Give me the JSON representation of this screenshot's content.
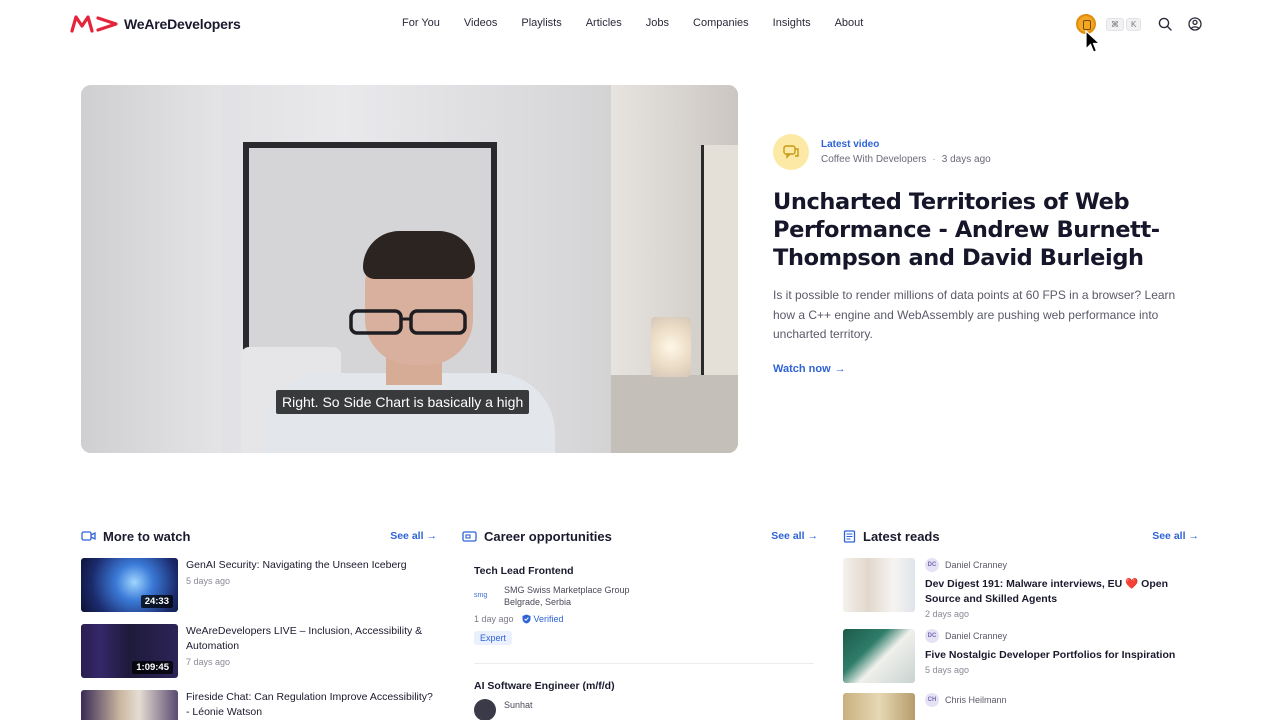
{
  "header": {
    "logo_text": "WeAreDevelopers",
    "nav": [
      "For You",
      "Videos",
      "Playlists",
      "Articles",
      "Jobs",
      "Companies",
      "Insights",
      "About"
    ],
    "shortcut_keys": [
      "⌘",
      "K"
    ]
  },
  "hero": {
    "subtitle_caption": "Right. So Side Chart is basically a high",
    "badge_label": "Latest video",
    "channel": "Coffee With Developers",
    "separator": "·",
    "age": "3 days ago",
    "title": "Uncharted Territories of Web Performance - Andrew Burnett-Thompson and David Burleigh",
    "description": "Is it possible to render millions of data points at 60 FPS in a browser? Learn how a C++ engine and WebAssembly are pushing web performance into uncharted territory.",
    "cta": "Watch now",
    "cta_arrow": "→"
  },
  "more_to_watch": {
    "title": "More to watch",
    "see_all": "See all",
    "items": [
      {
        "title": "GenAI Security: Navigating the Unseen Iceberg",
        "date": "5 days ago",
        "duration": "24:33"
      },
      {
        "title": "WeAreDevelopers LIVE – Inclusion, Accessibility & Automation",
        "date": "7 days ago",
        "duration": "1:09:45"
      },
      {
        "title": "Fireside Chat: Can Regulation Improve Accessibility? - Léonie Watson",
        "date": "",
        "duration": ""
      }
    ]
  },
  "careers": {
    "title": "Career opportunities",
    "see_all": "See all",
    "jobs": [
      {
        "title": "Tech Lead Frontend",
        "logo_text": "smg",
        "company": "SMG Swiss Marketplace Group",
        "location": "Belgrade, Serbia",
        "age": "1 day ago",
        "verified": "Verified",
        "tag": "Expert"
      },
      {
        "title": "AI Software Engineer (m/f/d)",
        "company": "Sunhat"
      }
    ]
  },
  "latest_reads": {
    "title": "Latest reads",
    "see_all": "See all",
    "items": [
      {
        "initials": "DC",
        "author": "Daniel Cranney",
        "title": "Dev Digest 191: Malware interviews, EU ❤️ Open Source and Skilled Agents",
        "date": "2 days ago"
      },
      {
        "initials": "DC",
        "author": "Daniel Cranney",
        "title": "Five Nostalgic Developer Portfolios for Inspiration",
        "date": "5 days ago"
      },
      {
        "initials": "CH",
        "author": "Chris Heilmann",
        "title": "",
        "date": ""
      }
    ]
  },
  "colors": {
    "accent": "#2f63d6",
    "brand": "#e5243b",
    "badge_bg": "#fde9a6"
  }
}
